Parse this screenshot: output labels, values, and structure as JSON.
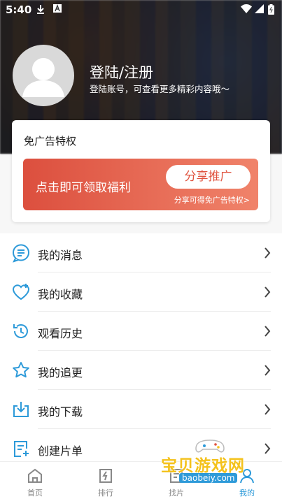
{
  "status_bar": {
    "time": "5:40"
  },
  "profile": {
    "title": "登陆/注册",
    "subtitle": "登陆账号，可查看更多精彩内容哦～"
  },
  "ad_card": {
    "title": "免广告特权",
    "promo_text": "点击即可领取福利",
    "share_button": "分享推广",
    "note": "分享可得免广告特权>"
  },
  "menu": {
    "items": [
      {
        "label": "我的消息",
        "icon": "message-icon"
      },
      {
        "label": "我的收藏",
        "icon": "favorite-heart-icon"
      },
      {
        "label": "观看历史",
        "icon": "history-icon"
      },
      {
        "label": "我的追更",
        "icon": "star-icon"
      },
      {
        "label": "我的下载",
        "icon": "download-icon"
      },
      {
        "label": "创建片单",
        "icon": "playlist-icon"
      }
    ]
  },
  "tabbar": {
    "tabs": [
      {
        "label": "首页",
        "icon": "home-icon"
      },
      {
        "label": "排行",
        "icon": "ranking-icon"
      },
      {
        "label": "找片",
        "icon": "find-icon"
      },
      {
        "label": "我的",
        "icon": "profile-icon"
      }
    ]
  },
  "watermark": {
    "name": "宝贝游戏网",
    "url": "baobeiy.com"
  },
  "colors": {
    "accent_blue": "#2d9ad9",
    "promo_red": "#dc4f3e",
    "promo_orange": "#f0836a",
    "active_tab": "#2d9ad9"
  }
}
